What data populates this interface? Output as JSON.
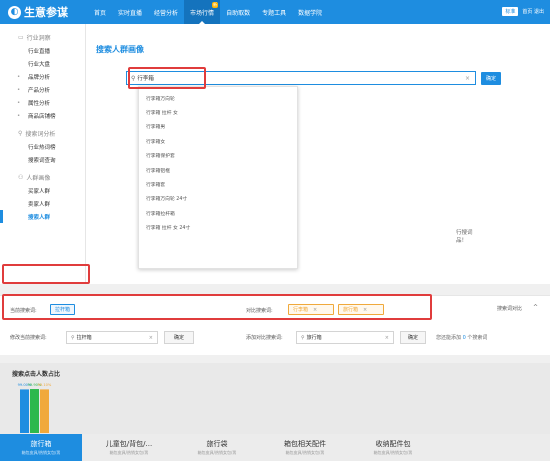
{
  "app": {
    "logo_text": "生意参谋",
    "version_label": "标准",
    "user_text": "首页 退出"
  },
  "nav": [
    {
      "label": "首页"
    },
    {
      "label": "实时直播"
    },
    {
      "label": "经营分析"
    },
    {
      "label": "市场行情",
      "active": true,
      "badge": "新"
    },
    {
      "label": "自助取数"
    },
    {
      "label": "专题工具"
    },
    {
      "label": "数据学院"
    }
  ],
  "sidebar": {
    "groups": [
      {
        "title": "行业洞察",
        "icon": "monitor-icon",
        "items": [
          {
            "label": "行业直播",
            "bullet": false
          },
          {
            "label": "行业大盘",
            "bullet": false
          },
          {
            "label": "品牌分析",
            "bullet": true
          },
          {
            "label": "产品分析",
            "bullet": true
          },
          {
            "label": "属性分析",
            "bullet": true
          },
          {
            "label": "商品店铺榜",
            "bullet": true
          }
        ]
      },
      {
        "title": "搜索词分析",
        "icon": "search-icon",
        "items": [
          {
            "label": "行业热词榜",
            "bullet": false
          },
          {
            "label": "搜索词查询",
            "bullet": false
          }
        ]
      },
      {
        "title": "人群画像",
        "icon": "people-icon",
        "items": [
          {
            "label": "买家人群",
            "bullet": false
          },
          {
            "label": "卖家人群",
            "bullet": false
          },
          {
            "label": "搜索人群",
            "bullet": false,
            "active": true
          }
        ]
      }
    ]
  },
  "main": {
    "title": "搜索人群画像",
    "search": {
      "value": "行李箱",
      "confirm_label": "确定"
    },
    "suggestions": [
      "行李箱万向轮",
      "行李箱 拉杆 女",
      "行李箱男",
      "行李箱女",
      "行李箱保护套",
      "行李箱铝框",
      "行李箱套",
      "行李箱万向轮 24寸",
      "行李箱拉杆箱",
      "行李箱 拉杆 女 24寸"
    ],
    "side_hint": [
      "行搜词",
      "品！"
    ]
  },
  "compare": {
    "current_label": "当前搜索词:",
    "current_tag": "拉杆箱",
    "compare_label": "对比搜索词:",
    "compare_tags": [
      "行李箱",
      "旅行箱"
    ],
    "collapse_label": "搜索词对比",
    "row2": {
      "modify_label": "修改当前搜索词:",
      "modify_value": "拉杆箱",
      "confirm_label": "确定",
      "add_label": "添加对比搜索词:",
      "add_value": "旅行箱",
      "add_confirm_label": "确定",
      "tip_prefix": "您还能添加",
      "tip_count": "0",
      "tip_suffix": "个搜索词"
    }
  },
  "chart_data": {
    "type": "bar",
    "title": "搜索点击人数占比",
    "categories": [
      "拉杆箱",
      "行李箱",
      "旅行箱"
    ],
    "values": [
      99.0,
      99.9,
      99.1
    ],
    "colors": [
      "#1e8de0",
      "#2db84d",
      "#f0a93b"
    ],
    "data_labels": [
      "99.00%",
      "99.90%",
      "99.10%"
    ],
    "ylim": [
      0,
      100
    ]
  },
  "categories": [
    {
      "name": "旅行箱",
      "sub": "箱包皮具/热销女包/男",
      "active": true
    },
    {
      "name": "儿童包/背包/...",
      "sub": "箱包皮具/热销女包/男"
    },
    {
      "name": "旅行袋",
      "sub": "箱包皮具/热销女包/男"
    },
    {
      "name": "箱包相关配件",
      "sub": "箱包皮具/热销女包/男"
    },
    {
      "name": "收纳配件包",
      "sub": "箱包皮具/热销女包/男"
    }
  ]
}
